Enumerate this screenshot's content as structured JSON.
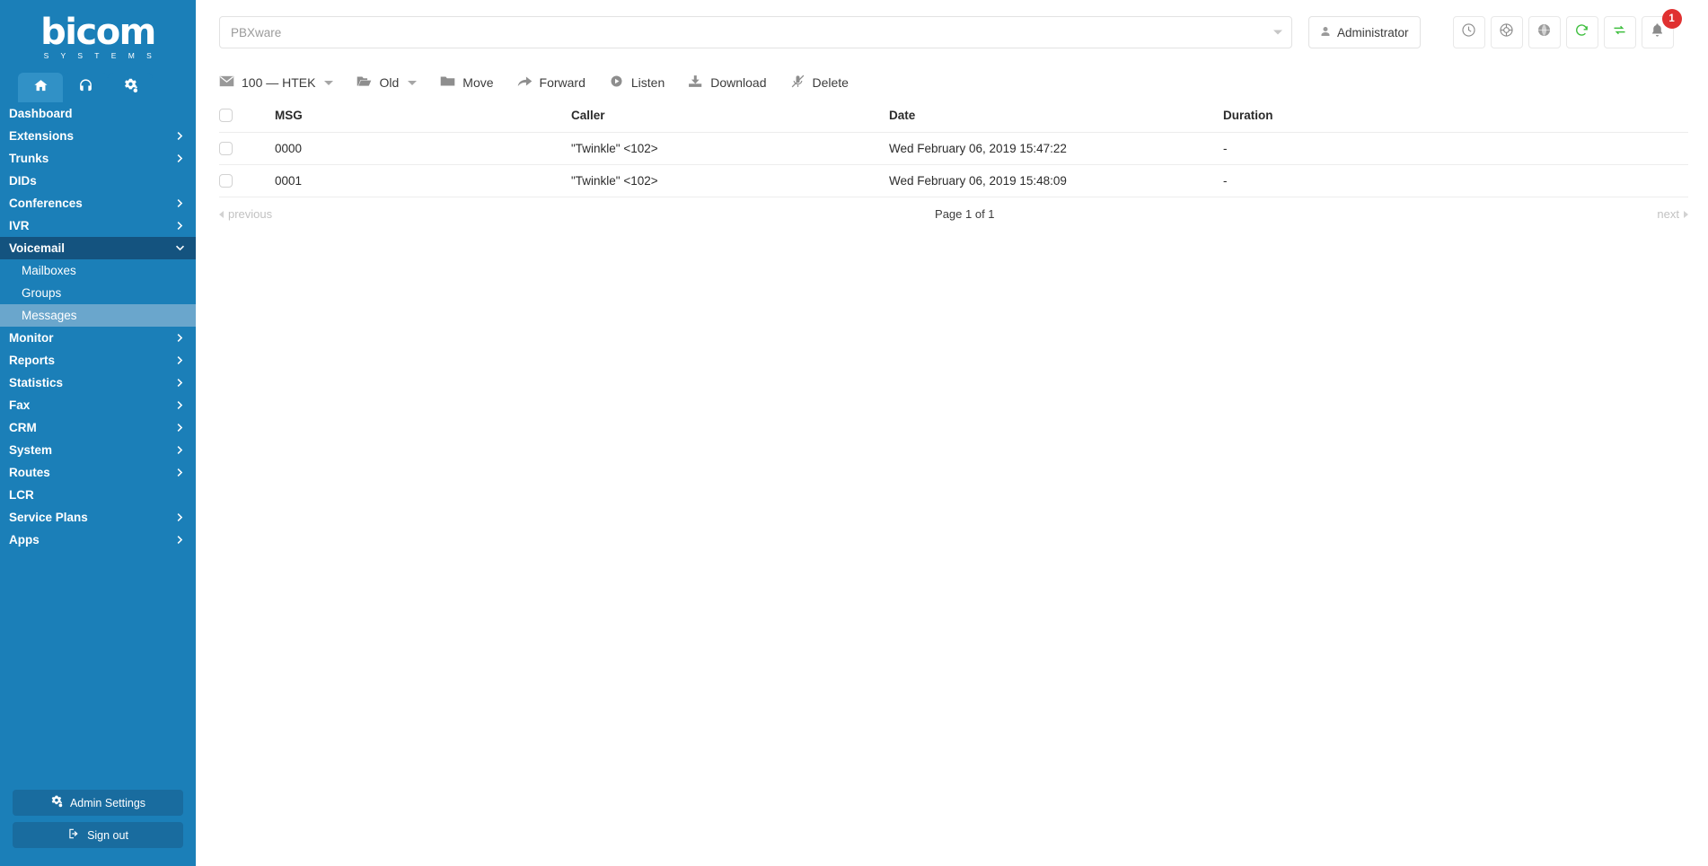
{
  "brand": {
    "name": "bicom",
    "tagline": "S Y S T E M S",
    "sidebar_bg": "#1b7fb8",
    "sidebar_active_bg": "#14537f",
    "sidebar_selected_bg": "#6aa6cc",
    "accent_green": "#3fbf3f",
    "badge_red": "#e03131"
  },
  "sidebar": {
    "tabs": [
      {
        "icon": "home-icon",
        "active": true
      },
      {
        "icon": "headset-icon",
        "active": false
      },
      {
        "icon": "gears-icon",
        "active": false
      }
    ],
    "items": [
      {
        "label": "Dashboard",
        "expandable": false
      },
      {
        "label": "Extensions",
        "expandable": true
      },
      {
        "label": "Trunks",
        "expandable": true
      },
      {
        "label": "DIDs",
        "expandable": false
      },
      {
        "label": "Conferences",
        "expandable": true
      },
      {
        "label": "IVR",
        "expandable": true
      },
      {
        "label": "Voicemail",
        "expandable": true,
        "expanded": true,
        "children": [
          {
            "label": "Mailboxes",
            "selected": false
          },
          {
            "label": "Groups",
            "selected": false
          },
          {
            "label": "Messages",
            "selected": true
          }
        ]
      },
      {
        "label": "Monitor",
        "expandable": true
      },
      {
        "label": "Reports",
        "expandable": true
      },
      {
        "label": "Statistics",
        "expandable": true
      },
      {
        "label": "Fax",
        "expandable": true
      },
      {
        "label": "CRM",
        "expandable": true
      },
      {
        "label": "System",
        "expandable": true
      },
      {
        "label": "Routes",
        "expandable": true
      },
      {
        "label": "LCR",
        "expandable": false
      },
      {
        "label": "Service Plans",
        "expandable": true
      },
      {
        "label": "Apps",
        "expandable": true
      }
    ],
    "footer": {
      "admin_settings": "Admin Settings",
      "sign_out": "Sign out"
    }
  },
  "topbar": {
    "search": {
      "value": "PBXware",
      "placeholder": "PBXware"
    },
    "admin_label": "Administrator",
    "tools": [
      {
        "name": "clock-icon",
        "title": "clock"
      },
      {
        "name": "life-ring-icon",
        "title": "help"
      },
      {
        "name": "globe-icon",
        "title": "language"
      },
      {
        "name": "reload-icon",
        "title": "reload"
      },
      {
        "name": "sync-icon",
        "title": "sync"
      },
      {
        "name": "bell-icon",
        "title": "notifications",
        "badge": "1"
      }
    ]
  },
  "toolbar": {
    "mailbox": "100 — HTEK",
    "folder": "Old",
    "move": "Move",
    "forward": "Forward",
    "listen": "Listen",
    "download": "Download",
    "delete": "Delete"
  },
  "table": {
    "headers": [
      "MSG",
      "Caller",
      "Date",
      "Duration"
    ],
    "rows": [
      {
        "msg": "0000",
        "caller": "\"Twinkle\" <102>",
        "date": "Wed February 06, 2019 15:47:22",
        "duration": "-"
      },
      {
        "msg": "0001",
        "caller": "\"Twinkle\" <102>",
        "date": "Wed February 06, 2019 15:48:09",
        "duration": "-"
      }
    ]
  },
  "pager": {
    "previous": "previous",
    "page_info": "Page 1 of 1",
    "next": "next"
  }
}
